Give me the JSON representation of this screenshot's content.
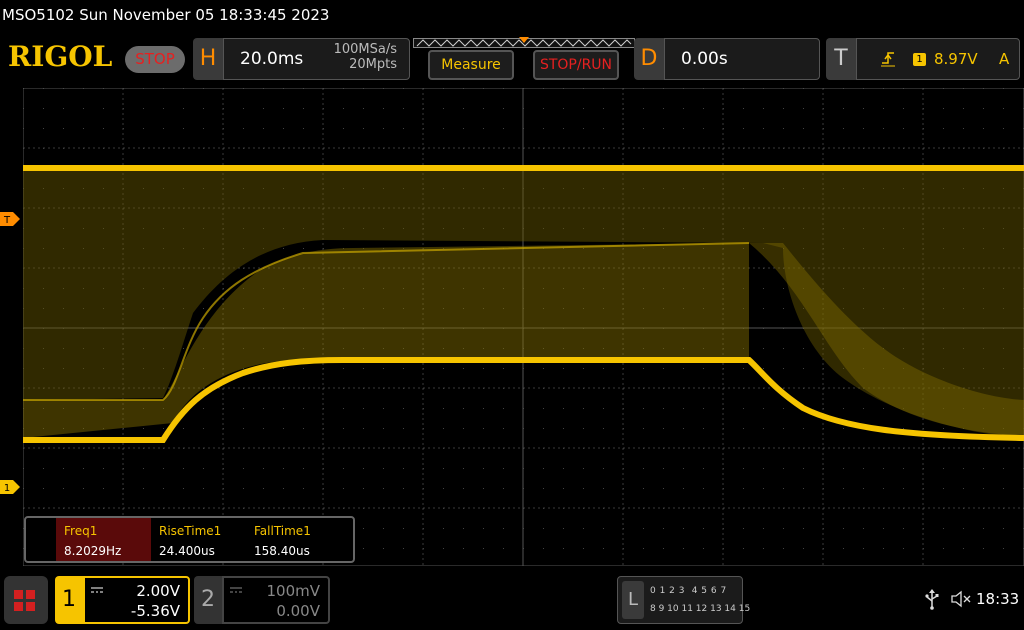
{
  "window": {
    "title": "MSO5102  Sun November 05 18:33:45 2023"
  },
  "header": {
    "brand": "RIGOL",
    "run_state": "STOP",
    "horizontal": {
      "letter": "H",
      "timebase": "20.0ms",
      "sample_rate": "100MSa/s",
      "memory_depth": "20Mpts"
    },
    "measure_label": "Measure",
    "stop_run_label": "STOP/RUN",
    "delay": {
      "letter": "D",
      "value": "0.00s"
    },
    "trigger": {
      "letter": "T",
      "source": "1",
      "level": "8.97V",
      "mode": "A",
      "edge_icon": "rising-edge-icon"
    }
  },
  "markers": {
    "trigger_top": "T",
    "trigger_level": "T",
    "ch1_ground": "1"
  },
  "measurements": [
    {
      "name": "Freq1",
      "value": "8.2029Hz"
    },
    {
      "name": "RiseTime1",
      "value": "24.400us"
    },
    {
      "name": "FallTime1",
      "value": "158.40us"
    }
  ],
  "channels": [
    {
      "number": "1",
      "scale": "2.00V",
      "offset": "-5.36V",
      "active": true
    },
    {
      "number": "2",
      "scale": "100mV",
      "offset": "0.00V",
      "active": false
    }
  ],
  "logic_analyzer": {
    "letter": "L",
    "row1": "0 1 2 3  4 5 6 7",
    "row2": "8 9 10 11 12 13 14 15"
  },
  "status": {
    "time": "18:33",
    "usb_icon": "usb-icon",
    "speaker_icon": "speaker-muted-icon"
  },
  "colors": {
    "ch1": "#f6c400",
    "accent_orange": "#ff8c00",
    "stop_red": "#e62020",
    "grid": "#3a3a3a"
  }
}
